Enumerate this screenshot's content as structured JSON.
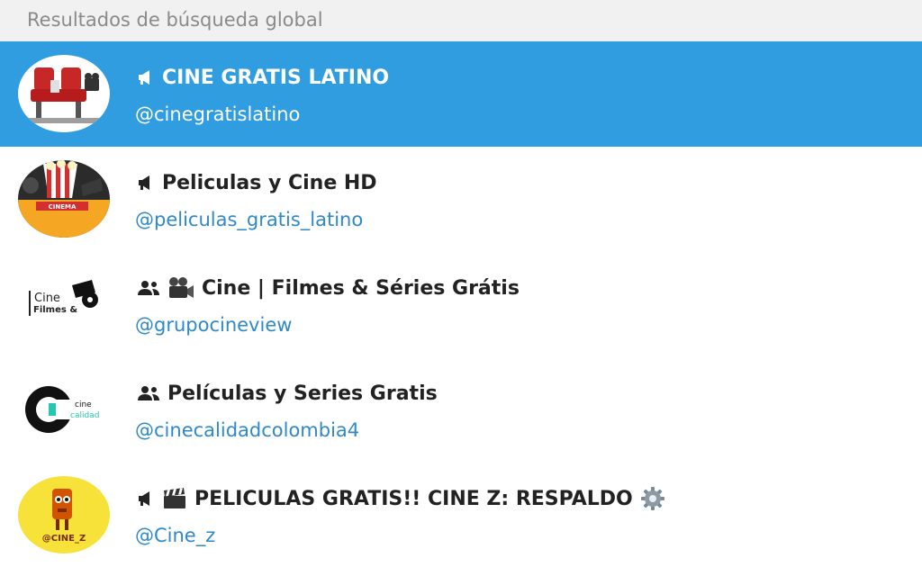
{
  "header": {
    "title": "Resultados de búsqueda global"
  },
  "results": [
    {
      "title": "CINE GRATIS LATINO",
      "handle": "@cinegratislatino",
      "type_icon": "megaphone-icon",
      "extra_icon": "",
      "selected": true
    },
    {
      "title": "Peliculas y Cine HD",
      "handle": "@peliculas_gratis_latino",
      "type_icon": "megaphone-icon",
      "extra_icon": "",
      "selected": false,
      "avatar_label": "CINEMA"
    },
    {
      "title": "Cine | Filmes & Séries Grátis",
      "handle": "@grupocineview",
      "type_icon": "group-icon",
      "extra_icon": "movie-camera-icon",
      "selected": false,
      "avatar_label_1": "Cine",
      "avatar_label_2": "Filmes &"
    },
    {
      "title": "Películas y Series Gratis",
      "handle": "@cinecalidadcolombia4",
      "type_icon": "group-icon",
      "extra_icon": "",
      "selected": false,
      "avatar_label_1": "cine",
      "avatar_label_2": "calidad"
    },
    {
      "title": "PELICULAS GRATIS!! CINE Z: RESPALDO",
      "handle": "@Cine_z",
      "type_icon": "megaphone-icon",
      "extra_icon": "clapperboard-icon",
      "trailing_icon": "gear-icon",
      "selected": false,
      "avatar_label": "@CINE_Z"
    }
  ],
  "colors": {
    "selected_bg": "#2f9ddf",
    "handle": "#2f89c8",
    "header_bg": "#f1f1f1"
  }
}
